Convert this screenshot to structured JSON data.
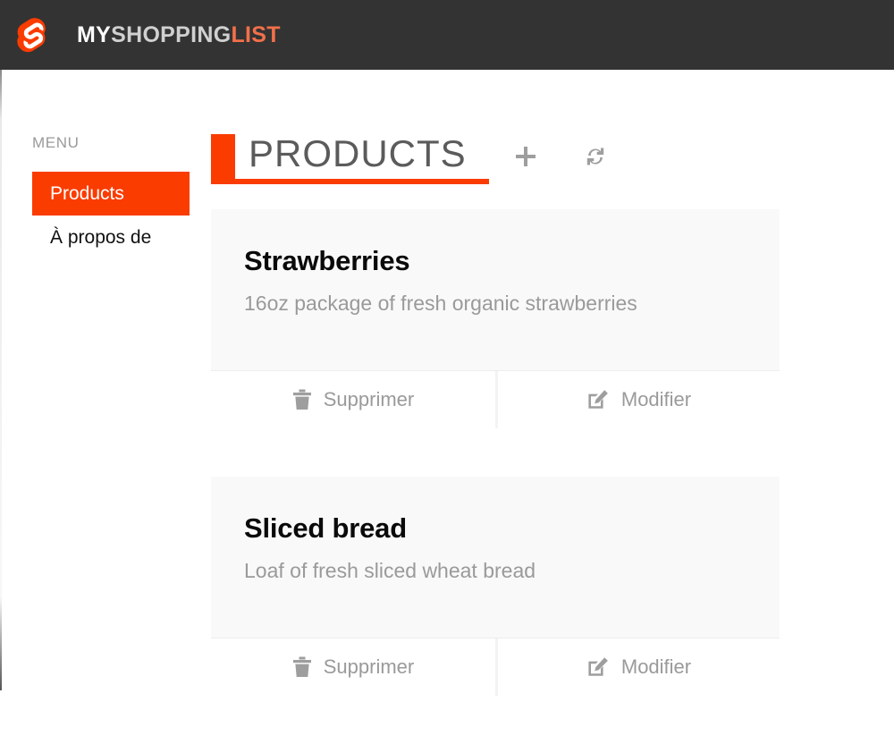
{
  "header": {
    "logo_icon": "svelte-s-logo-icon",
    "brand_part1": "MY",
    "brand_part2": "SHOPPING",
    "brand_part3": "LIST",
    "bg_color": "#333333",
    "accent_color": "#fa3c00"
  },
  "sidebar": {
    "label": "MENU",
    "items": [
      {
        "label": "Products",
        "active": true
      },
      {
        "label": "À propos de",
        "active": false
      }
    ]
  },
  "main": {
    "title": "PRODUCTS",
    "add_icon": "plus-icon",
    "refresh_icon": "refresh-icon",
    "accent_color": "#fa3c00"
  },
  "products": [
    {
      "title": "Strawberries",
      "description": "16oz package of fresh organic strawberries",
      "delete_label": "Supprimer",
      "edit_label": "Modifier",
      "delete_icon": "trash-icon",
      "edit_icon": "edit-pencil-icon"
    },
    {
      "title": "Sliced bread",
      "description": "Loaf of fresh sliced wheat bread",
      "delete_label": "Supprimer",
      "edit_label": "Modifier",
      "delete_icon": "trash-icon",
      "edit_icon": "edit-pencil-icon"
    }
  ]
}
